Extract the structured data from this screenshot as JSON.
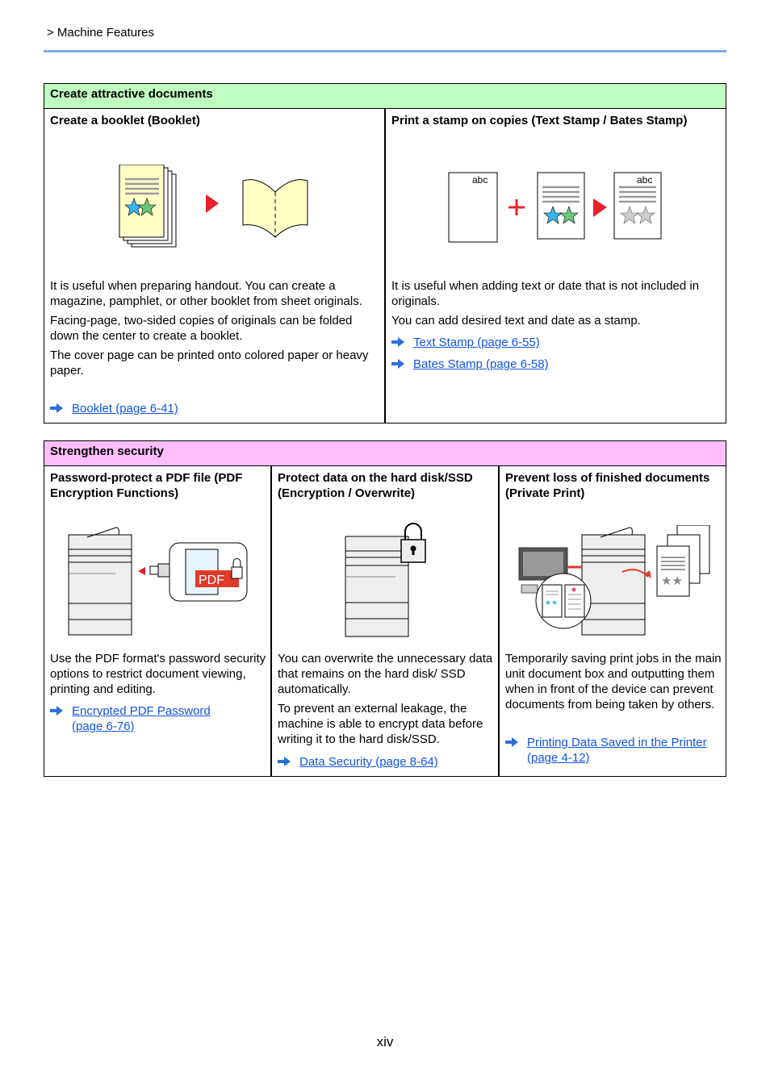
{
  "header": {
    "breadcrumb": "> Machine Features"
  },
  "sections": [
    {
      "title": "Create attractive documents",
      "color": "#bfffbf",
      "cells": [
        {
          "title": "Create a booklet (Booklet)",
          "paragraphs": [
            "It is useful when preparing handout. You can create a magazine, pamphlet, or other booklet from sheet originals.",
            "Facing-page, two-sided copies of originals can be folded down the center to create a booklet.",
            "The cover page can be printed onto colored paper or heavy paper."
          ],
          "links": [
            "Booklet (page 6-41)"
          ]
        },
        {
          "title": "Print a stamp on copies (Text Stamp / Bates Stamp)",
          "stamp_text": "abc",
          "paragraphs": [
            "It is useful when adding text or date that is not included in originals.",
            "You can add desired text and date as a stamp."
          ],
          "links": [
            "Text Stamp (page 6-55)",
            "Bates Stamp (page 6-58)"
          ]
        }
      ]
    },
    {
      "title": "Strengthen security",
      "color": "#ffbfff",
      "cells": [
        {
          "title": "Password-protect a PDF file (PDF Encryption Functions)",
          "pdf_label": "PDF",
          "paragraphs": [
            "Use the PDF format's password security options to restrict document viewing, printing and editing."
          ],
          "links": [
            "Encrypted PDF Password (page 6-76)"
          ]
        },
        {
          "title": "Protect data on the hard disk/SSD (Encryption / Overwrite)",
          "paragraphs": [
            "You can overwrite the unnecessary data that remains on the hard disk/ SSD automatically.",
            "To prevent an external leakage, the machine is able to encrypt data before writing it to the hard disk/SSD."
          ],
          "links": [
            "Data Security (page 8-64)"
          ]
        },
        {
          "title": "Prevent loss of finished documents (Private Print)",
          "paragraphs": [
            "Temporarily saving print jobs in the main unit document box and outputting them when in front of the device can prevent documents from being taken by others."
          ],
          "links": [
            "Printing Data Saved in the Printer (page 4-12)"
          ]
        }
      ]
    }
  ],
  "footer": {
    "page_number": "xiv"
  },
  "colors": {
    "link": "#1155dd",
    "accent_red": "#e8212a",
    "rule": "#7aa7f5"
  }
}
